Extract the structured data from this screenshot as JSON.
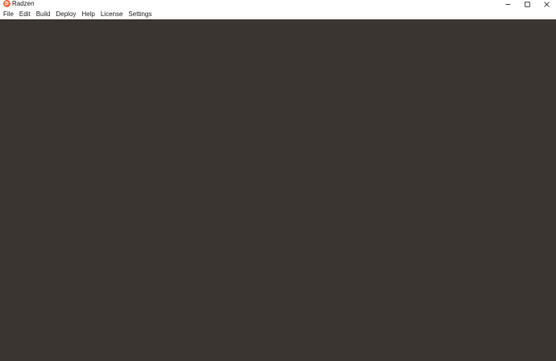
{
  "window": {
    "title": "Radzen",
    "app_icon": "radzen-logo-icon",
    "controls": {
      "minimize_icon": "minimize-icon",
      "maximize_icon": "maximize-icon",
      "close_icon": "close-icon"
    }
  },
  "menu": {
    "items": [
      {
        "label": "File"
      },
      {
        "label": "Edit"
      },
      {
        "label": "Build"
      },
      {
        "label": "Deploy"
      },
      {
        "label": "Help"
      },
      {
        "label": "License"
      },
      {
        "label": "Settings"
      }
    ]
  },
  "colors": {
    "brand": "#f26b3a",
    "workspace": "#3b3532",
    "chrome": "#ffffff"
  }
}
